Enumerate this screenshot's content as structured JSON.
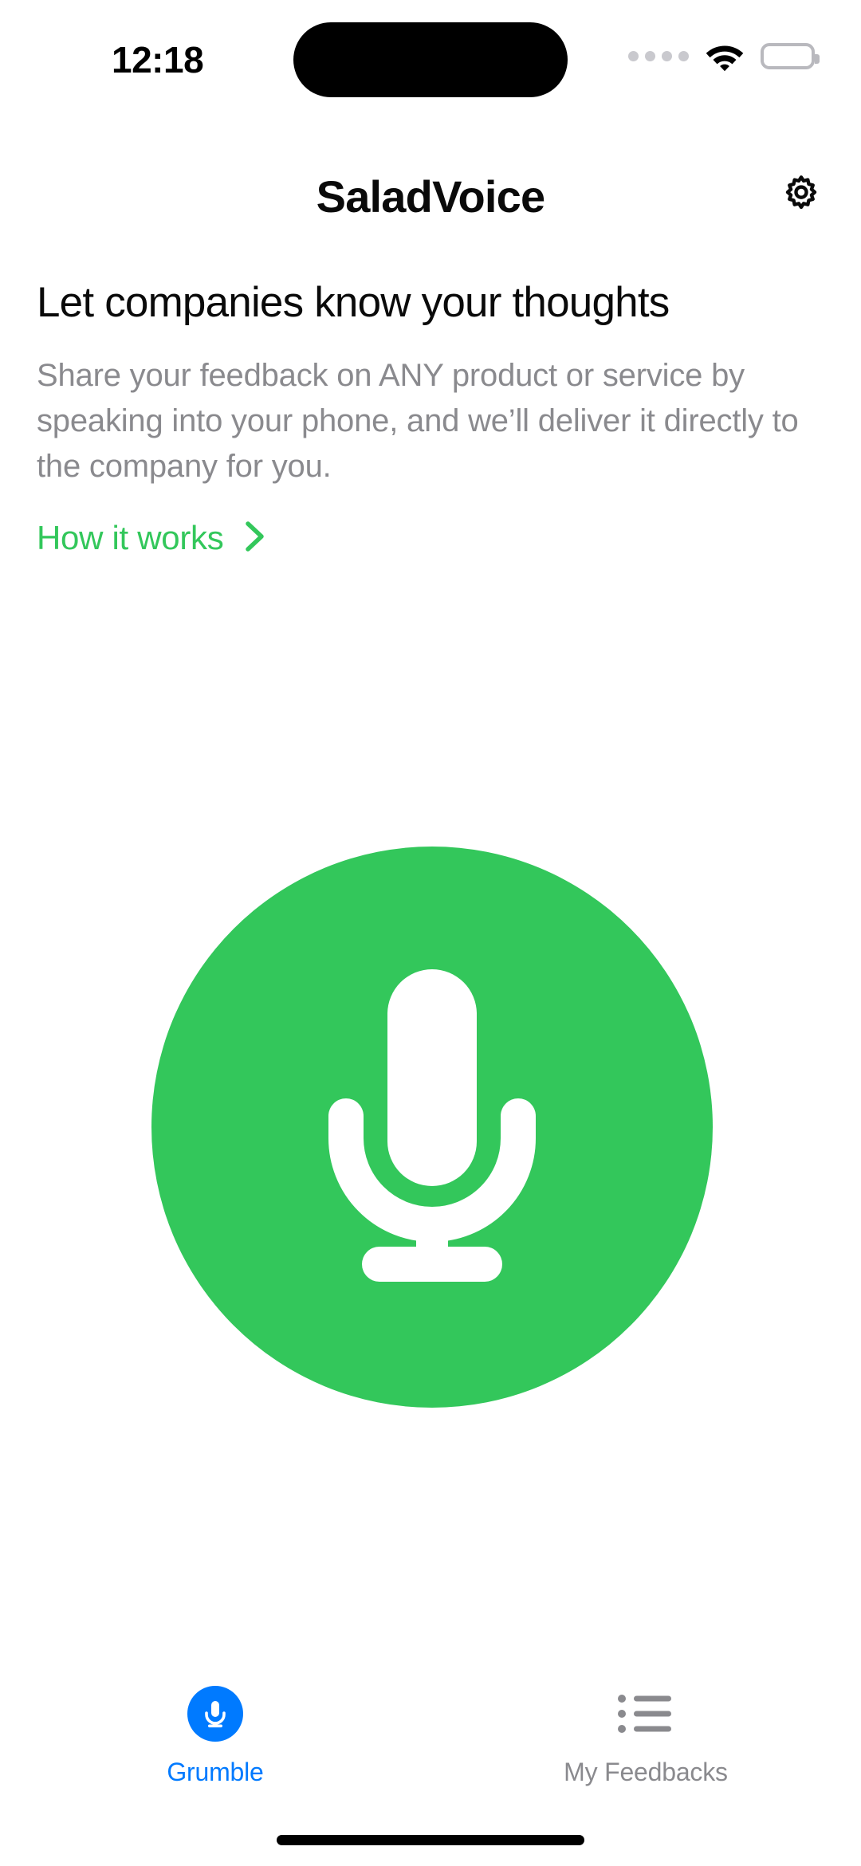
{
  "status_bar": {
    "time": "12:18",
    "signal_icon": "signal-dots-icon",
    "wifi_icon": "wifi-icon",
    "battery_icon": "battery-icon"
  },
  "header": {
    "title": "SaladVoice",
    "settings_icon": "gear-icon"
  },
  "main": {
    "headline": "Let companies know your thoughts",
    "description": "Share your feedback on ANY product or service by speaking into your phone, and we’ll deliver it directly to the company for you.",
    "how_it_works_label": "How it works",
    "how_it_works_chevron": "chevron-right-icon",
    "record_button": {
      "icon": "microphone-icon",
      "color": "#33c75b"
    }
  },
  "tab_bar": {
    "tabs": [
      {
        "label": "Grumble",
        "icon": "microphone-icon",
        "active": true
      },
      {
        "label": "My Feedbacks",
        "icon": "list-icon",
        "active": false
      }
    ]
  },
  "colors": {
    "brand_green": "#33c75b",
    "accent_blue": "#007aff",
    "muted_grey": "#8a8a8e",
    "text_black": "#0a0a0a"
  }
}
